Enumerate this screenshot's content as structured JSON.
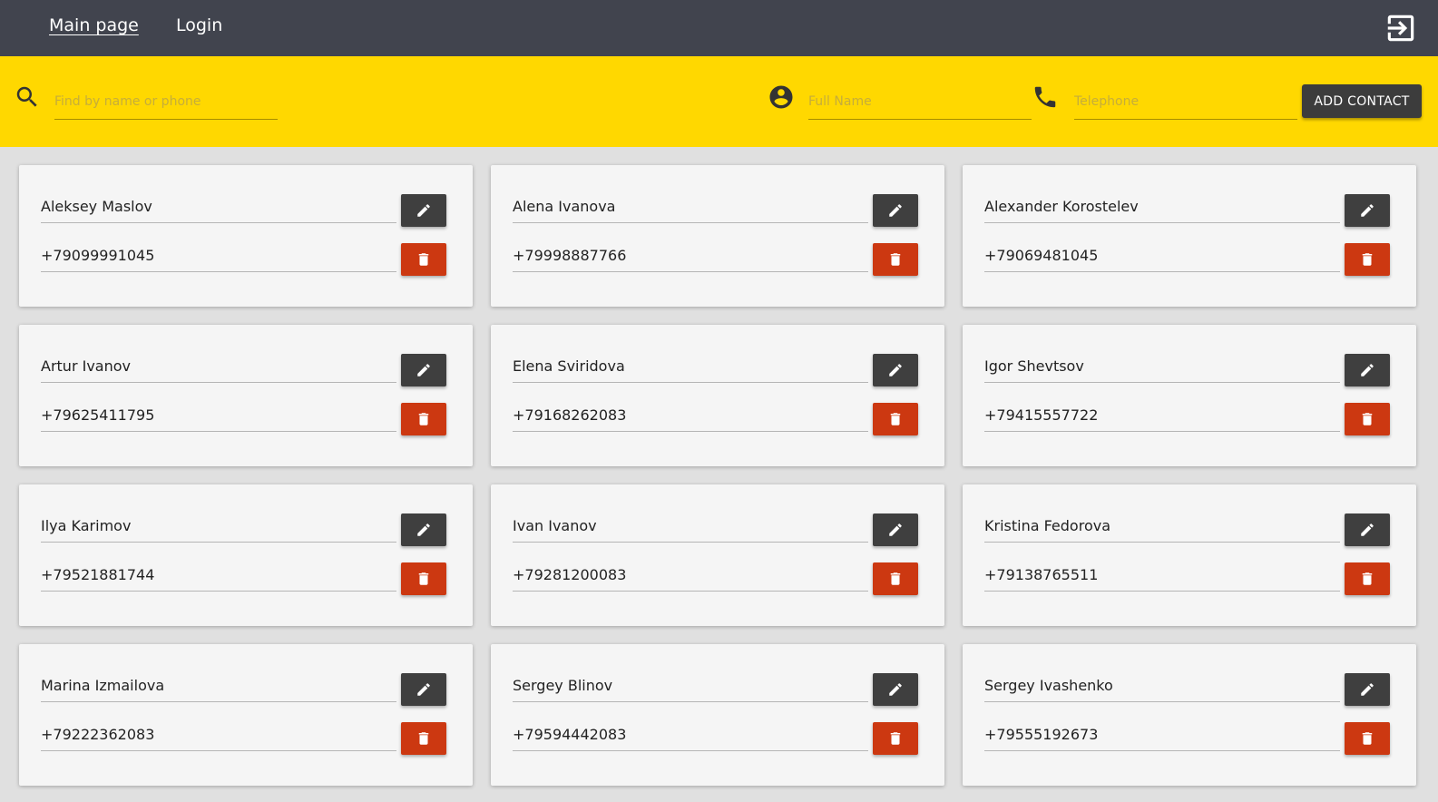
{
  "nav": {
    "main_label": "Main page",
    "login_label": "Login",
    "logout_icon": "logout-icon"
  },
  "toolbar": {
    "search_placeholder": "Find by name or phone",
    "fullname_placeholder": "Full Name",
    "phone_placeholder": "Telephone",
    "add_label": "ADD CONTACT"
  },
  "colors": {
    "topbar": "#41444e",
    "accent": "#ffd800",
    "edit_button": "#3f3f3f",
    "delete_button": "#cc3811"
  },
  "contacts": [
    {
      "name": "Aleksey Maslov",
      "phone": "+79099991045"
    },
    {
      "name": "Alena Ivanova",
      "phone": "+79998887766"
    },
    {
      "name": "Alexander Korostelev",
      "phone": "+79069481045"
    },
    {
      "name": "Artur Ivanov",
      "phone": "+79625411795"
    },
    {
      "name": "Elena Sviridova",
      "phone": "+79168262083"
    },
    {
      "name": "Igor Shevtsov",
      "phone": "+79415557722"
    },
    {
      "name": "Ilya Karimov",
      "phone": "+79521881744"
    },
    {
      "name": "Ivan Ivanov",
      "phone": "+79281200083"
    },
    {
      "name": "Kristina Fedorova",
      "phone": "+79138765511"
    },
    {
      "name": "Marina Izmailova",
      "phone": "+79222362083"
    },
    {
      "name": "Sergey Blinov",
      "phone": "+79594442083"
    },
    {
      "name": "Sergey Ivashenko",
      "phone": "+79555192673"
    }
  ]
}
